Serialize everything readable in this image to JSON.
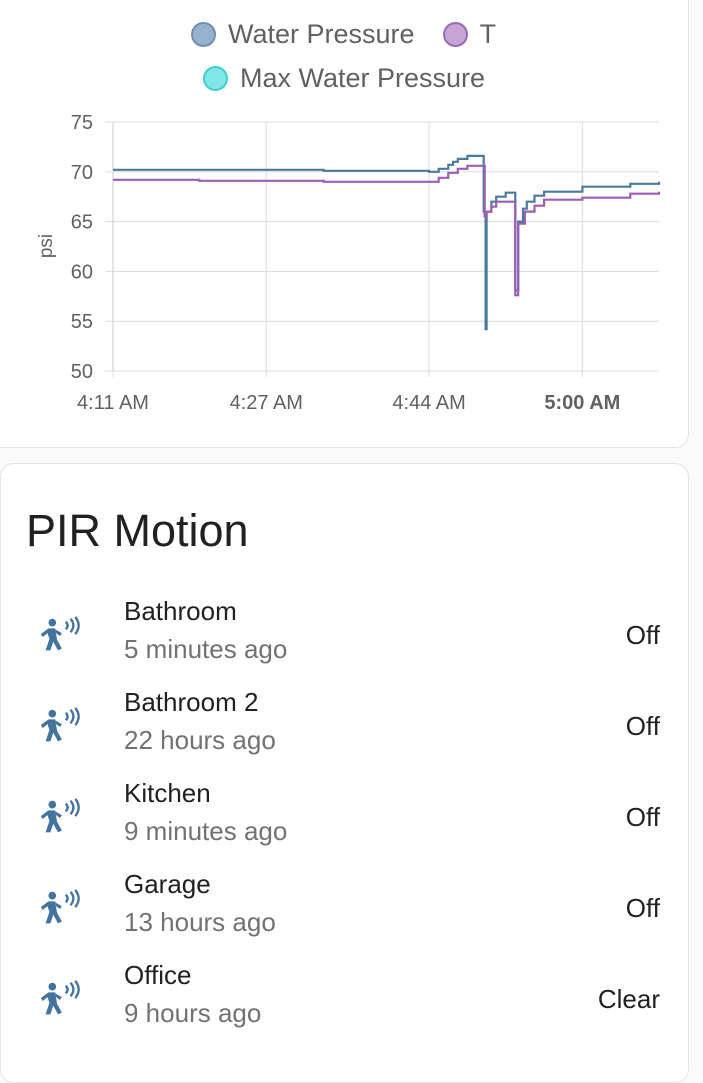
{
  "chart_card": {
    "legend": [
      {
        "label": "Water Pressure",
        "color": "#97b2cc",
        "border": "#6e8fb0"
      },
      {
        "label": "T",
        "color": "#c7a3d6",
        "border": "#9a6bb3"
      },
      {
        "label": "Max Water Pressure",
        "color": "#7fe5e5",
        "border": "#3fcfcf"
      }
    ]
  },
  "chart_data": {
    "type": "line",
    "title": "",
    "xlabel": "",
    "ylabel": "psi",
    "ylim": [
      50,
      75
    ],
    "yticks": [
      "75",
      "70",
      "65",
      "60",
      "55",
      "50"
    ],
    "xticks": [
      {
        "label": "4:11 AM",
        "bold": false
      },
      {
        "label": "4:27 AM",
        "bold": false
      },
      {
        "label": "4:44 AM",
        "bold": false
      },
      {
        "label": "5:00 AM",
        "bold": true
      }
    ],
    "xlim": [
      "4:11",
      "5:08"
    ],
    "grid": true,
    "series": [
      {
        "name": "Water Pressure",
        "color": "#4a7a9e",
        "points": [
          [
            "4:11",
            70.2
          ],
          [
            "4:33",
            70.1
          ],
          [
            "4:44",
            70.0
          ],
          [
            "4:45",
            70.3
          ],
          [
            "4:46",
            70.7
          ],
          [
            "4:46.5",
            71.0
          ],
          [
            "4:47",
            71.3
          ],
          [
            "4:48",
            71.6
          ],
          [
            "4:49.5",
            71.6
          ],
          [
            "4:49.7",
            66.0
          ],
          [
            "4:49.9",
            54.2
          ],
          [
            "4:50",
            66.0
          ],
          [
            "4:50.5",
            67.0
          ],
          [
            "4:51",
            67.5
          ],
          [
            "4:52",
            67.9
          ],
          [
            "4:52.7",
            67.9
          ],
          [
            "4:53",
            58.1
          ],
          [
            "4:53.3",
            65.0
          ],
          [
            "4:53.8",
            66.3
          ],
          [
            "4:54.2",
            67.0
          ],
          [
            "4:55",
            67.6
          ],
          [
            "4:56",
            68.0
          ],
          [
            "5:00",
            68.5
          ],
          [
            "5:05",
            68.8
          ],
          [
            "5:08",
            69.0
          ]
        ]
      },
      {
        "name": "T",
        "color": "#9a5fb5",
        "points": [
          [
            "4:11",
            69.2
          ],
          [
            "4:20",
            69.1
          ],
          [
            "4:33",
            69.0
          ],
          [
            "4:44",
            69.0
          ],
          [
            "4:45",
            69.4
          ],
          [
            "4:46",
            69.9
          ],
          [
            "4:47",
            70.3
          ],
          [
            "4:48",
            70.6
          ],
          [
            "4:49.5",
            70.6
          ],
          [
            "4:49.8",
            65.5
          ],
          [
            "4:50",
            66.0
          ],
          [
            "4:50.5",
            66.5
          ],
          [
            "4:51",
            67.0
          ],
          [
            "4:52.8",
            67.0
          ],
          [
            "4:53",
            57.6
          ],
          [
            "4:53.3",
            64.8
          ],
          [
            "4:54",
            66.0
          ],
          [
            "4:55",
            66.6
          ],
          [
            "4:56",
            67.2
          ],
          [
            "5:00",
            67.4
          ],
          [
            "5:05",
            67.8
          ],
          [
            "5:08",
            68.0
          ]
        ]
      }
    ]
  },
  "pir": {
    "title": "PIR Motion",
    "icon": "motion-sensor-icon",
    "icon_color": "#44739e",
    "items": [
      {
        "name": "Bathroom",
        "time": "5 minutes ago",
        "state": "Off"
      },
      {
        "name": "Bathroom 2",
        "time": "22 hours ago",
        "state": "Off"
      },
      {
        "name": "Kitchen",
        "time": "9 minutes ago",
        "state": "Off"
      },
      {
        "name": "Garage",
        "time": "13 hours ago",
        "state": "Off"
      },
      {
        "name": "Office",
        "time": "9 hours ago",
        "state": "Clear"
      }
    ]
  }
}
